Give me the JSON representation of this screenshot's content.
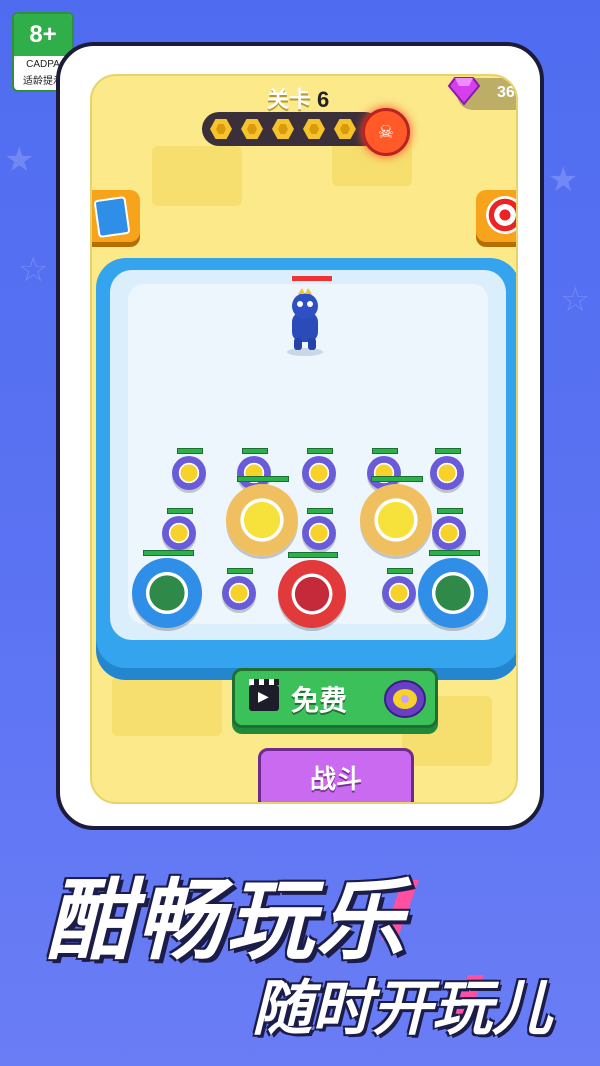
{
  "age_rating": {
    "age": "8+",
    "org": "CADPA",
    "hint": "适龄提示"
  },
  "hud": {
    "level_label": "关卡",
    "level_number": "6",
    "gems": "36",
    "progress_slots": 5
  },
  "buttons": {
    "free_label": "免费",
    "battle_label": "战斗"
  },
  "slogan": {
    "main": "酣畅玩乐",
    "sub": "随时开玩儿"
  },
  "colors": {
    "background": "#5b73f3",
    "free_button": "#3cc15a",
    "battle_button": "#c96af0",
    "arena": "#34a4ee"
  },
  "icons": [
    "gem-icon",
    "boss-badge-icon",
    "clapperboard-icon",
    "target-icon",
    "cards-icon",
    "spinning-top-icon"
  ]
}
